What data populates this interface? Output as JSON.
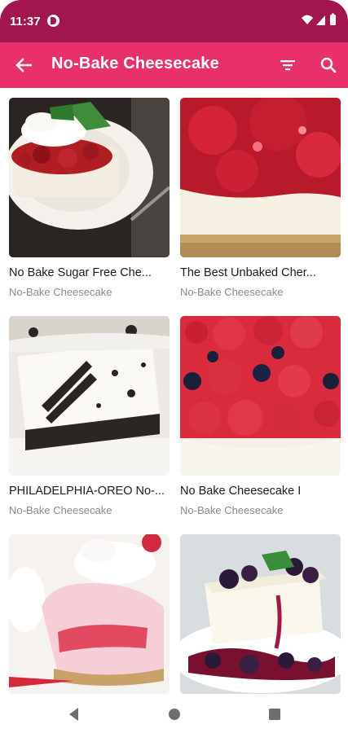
{
  "status_bar": {
    "time": "11:37",
    "icons": [
      "app-notification-icon",
      "wifi-icon",
      "signal-icon",
      "battery-icon"
    ],
    "background": "#a3154f"
  },
  "app_bar": {
    "title": "No-Bake Cheesecake",
    "background": "#e8306a",
    "icons": [
      "back-arrow-icon",
      "filter-icon",
      "search-icon"
    ]
  },
  "recipes": [
    {
      "title": "No Bake Sugar Free Che...",
      "category": "No-Bake Cheesecake"
    },
    {
      "title": "The Best Unbaked Cher...",
      "category": "No-Bake Cheesecake"
    },
    {
      "title": "PHILADELPHIA-OREO No-...",
      "category": "No-Bake Cheesecake"
    },
    {
      "title": "No Bake Cheesecake I",
      "category": "No-Bake Cheesecake"
    },
    {
      "title": "",
      "category": ""
    },
    {
      "title": "",
      "category": ""
    }
  ],
  "nav_bar": {
    "icons": [
      "back-triangle-icon",
      "home-circle-icon",
      "recents-square-icon"
    ]
  }
}
